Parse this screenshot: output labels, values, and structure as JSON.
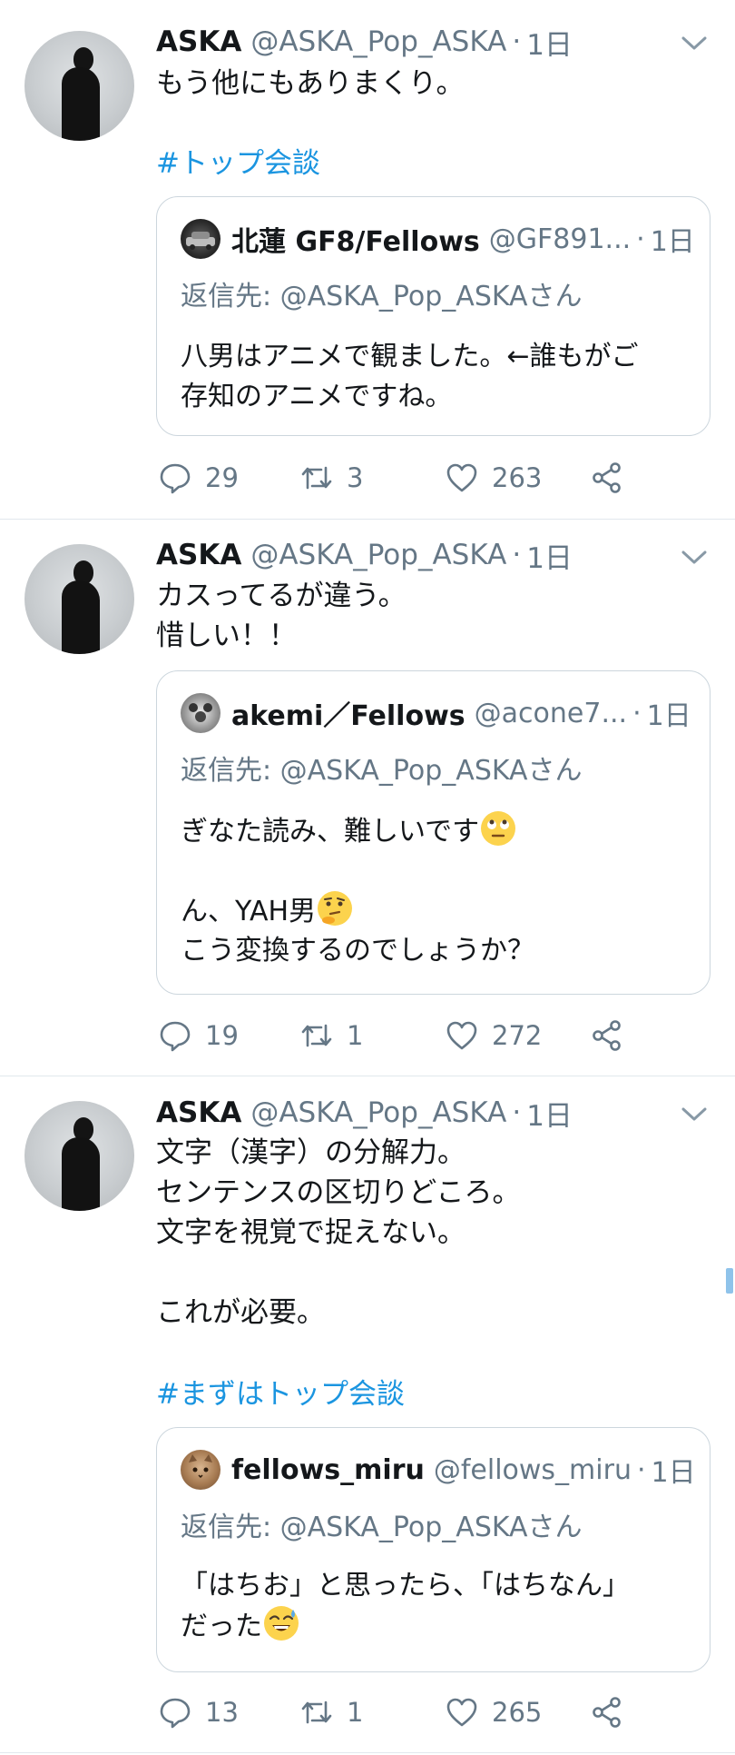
{
  "tweets": [
    {
      "author_name": "ASKA",
      "author_handle": "@ASKA_Pop_ASKA",
      "separator": "·",
      "time": "1日",
      "text": "もう他にもありまくり。",
      "hashtag": "#トップ会談",
      "quoted": {
        "name": "北蓮 GF8/Fellows",
        "handle": "@GF891...",
        "separator": "·",
        "time": "1日",
        "reply_to": "返信先: @ASKA_Pop_ASKAさん",
        "text": "八男はアニメで観ました。←誰もがご\n存知のアニメですね。"
      },
      "replies": "29",
      "retweets": "3",
      "likes": "263"
    },
    {
      "author_name": "ASKA",
      "author_handle": "@ASKA_Pop_ASKA",
      "separator": "·",
      "time": "1日",
      "text": "カスってるが違う。\n惜しい！！",
      "quoted": {
        "name": "akemi／Fellows",
        "handle": "@acone7...",
        "separator": "·",
        "time": "1日",
        "reply_to": "返信先: @ASKA_Pop_ASKAさん",
        "text_line1": "ぎなた読み、難しいです",
        "text_line2": "ん、YAH男",
        "text_line3": "こう変換するのでしょうか？"
      },
      "replies": "19",
      "retweets": "1",
      "likes": "272"
    },
    {
      "author_name": "ASKA",
      "author_handle": "@ASKA_Pop_ASKA",
      "separator": "·",
      "time": "1日",
      "text": "文字（漢字）の分解力。\nセンテンスの区切りどころ。\n文字を視覚で捉えない。\n\nこれが必要。",
      "hashtag": "#まずはトップ会談",
      "quoted": {
        "name": "fellows_miru",
        "handle": "@fellows_miru",
        "separator": "·",
        "time": "1日",
        "reply_to": "返信先: @ASKA_Pop_ASKAさん",
        "text_line1": "「はちお」と思ったら、「はちなん」",
        "text_line2": "だった"
      },
      "replies": "13",
      "retweets": "1",
      "likes": "265"
    }
  ],
  "colors": {
    "text": "#14171a",
    "secondary": "#657786",
    "link": "#1b95e0",
    "border": "#e1e8ed"
  },
  "icons": [
    "reply-icon",
    "retweet-icon",
    "like-icon",
    "share-icon",
    "chevron-down-icon",
    "rolling-eyes-emoji",
    "thinking-emoji",
    "sweat-smile-emoji"
  ]
}
